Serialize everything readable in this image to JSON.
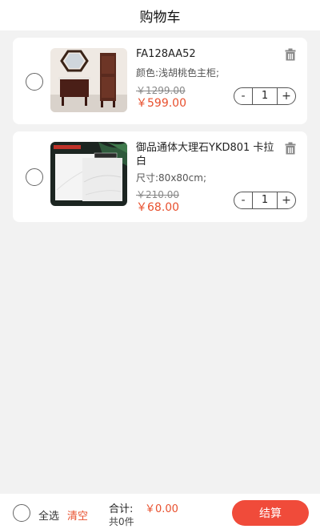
{
  "header": {
    "title": "购物车"
  },
  "items": [
    {
      "name": "FA128AA52",
      "spec": "颜色:浅胡桃色主柜;",
      "old_price": "￥1299.00",
      "price": "￥599.00",
      "qty": "1"
    },
    {
      "name": "御品通体大理石YKD801 卡拉白",
      "spec": "尺寸:80x80cm;",
      "old_price": "￥210.00",
      "price": "￥68.00",
      "qty": "1"
    }
  ],
  "stepper": {
    "minus": "-",
    "plus": "+"
  },
  "footer": {
    "select_all": "全选",
    "clear": "清空",
    "total_label": "合计:",
    "total_value": "￥0.00",
    "count": "共0件",
    "checkout": "结算"
  },
  "colors": {
    "accent": "#e8502e",
    "checkout": "#f04b3a",
    "background": "#f2f2f2"
  },
  "icons": {
    "delete": "trash-icon",
    "select": "radio-circle"
  }
}
